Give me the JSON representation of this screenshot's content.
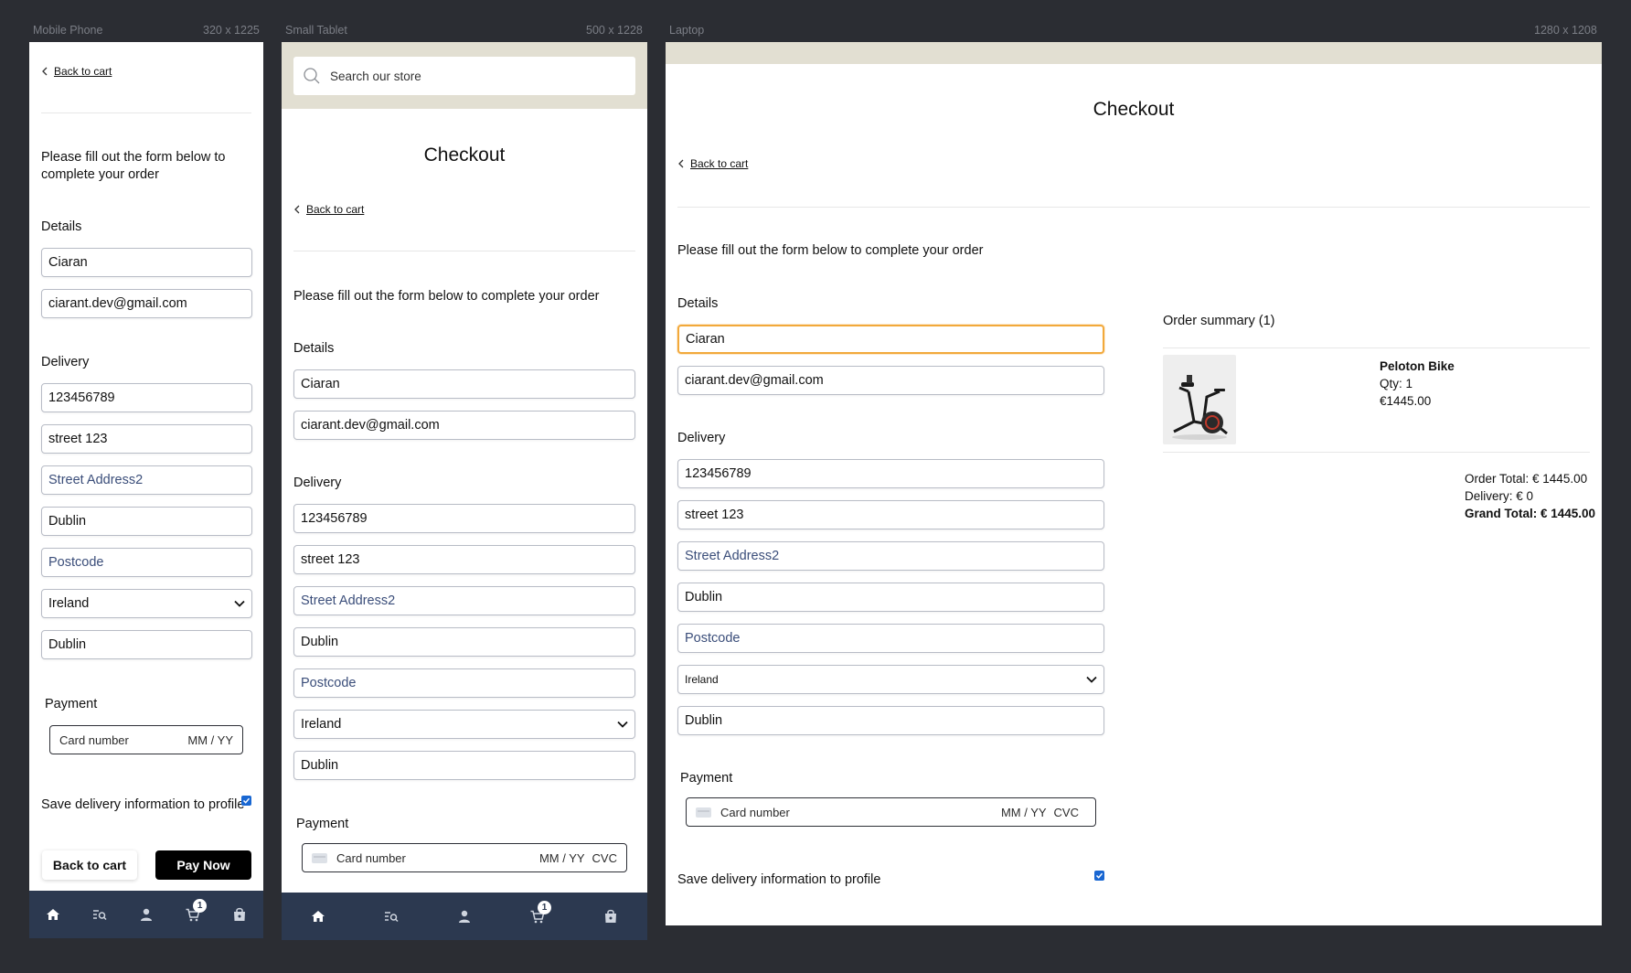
{
  "frames": {
    "mobile": {
      "name": "Mobile Phone",
      "size": "320 x 1225"
    },
    "tablet": {
      "name": "Small Tablet",
      "size": "500 x 1228"
    },
    "laptop": {
      "name": "Laptop",
      "size": "1280 x 1208"
    }
  },
  "checkout": {
    "title": "Checkout",
    "back_link": "Back to cart",
    "intro": "Please fill out the form below to complete your order",
    "intro_line1": "Please fill out the form below to",
    "intro_line2": "complete your order",
    "details_label": "Details",
    "name_value": "Ciaran",
    "email_value": "ciarant.dev@gmail.com",
    "delivery_label": "Delivery",
    "phone_value": "123456789",
    "street1_value": "street 123",
    "street2_placeholder": "Street Address2",
    "town_value": "Dublin",
    "postcode_placeholder": "Postcode",
    "country_value": "Ireland",
    "county_value": "Dublin",
    "payment_label": "Payment",
    "card_placeholder": "Card number",
    "expiry_placeholder": "MM / YY",
    "cvc_placeholder": "CVC",
    "save_info_label": "Save delivery information to profile",
    "save_info_checked": true,
    "back_button": "Back to cart",
    "pay_button": "Pay Now"
  },
  "search": {
    "placeholder": "Search our store"
  },
  "tabbar": {
    "items": [
      "home-icon",
      "search-list-icon",
      "user-icon",
      "cart-icon",
      "bag-icon"
    ],
    "cart_count": "1",
    "background": "#2c3950"
  },
  "summary": {
    "heading": "Order summary (1)",
    "item_name": "Peloton Bike",
    "item_qty": "Qty: 1",
    "item_price": "€1445.00",
    "order_total": "Order Total: € 1445.00",
    "delivery": "Delivery: € 0",
    "grand_total": "Grand Total: € 1445.00"
  },
  "colors": {
    "canvas": "#2b2d33",
    "search_bar_bg": "#e2dfd2",
    "focus_border": "#f2a93b",
    "checkbox": "#1967d2",
    "placeholder_text": "#3b4e7a"
  }
}
